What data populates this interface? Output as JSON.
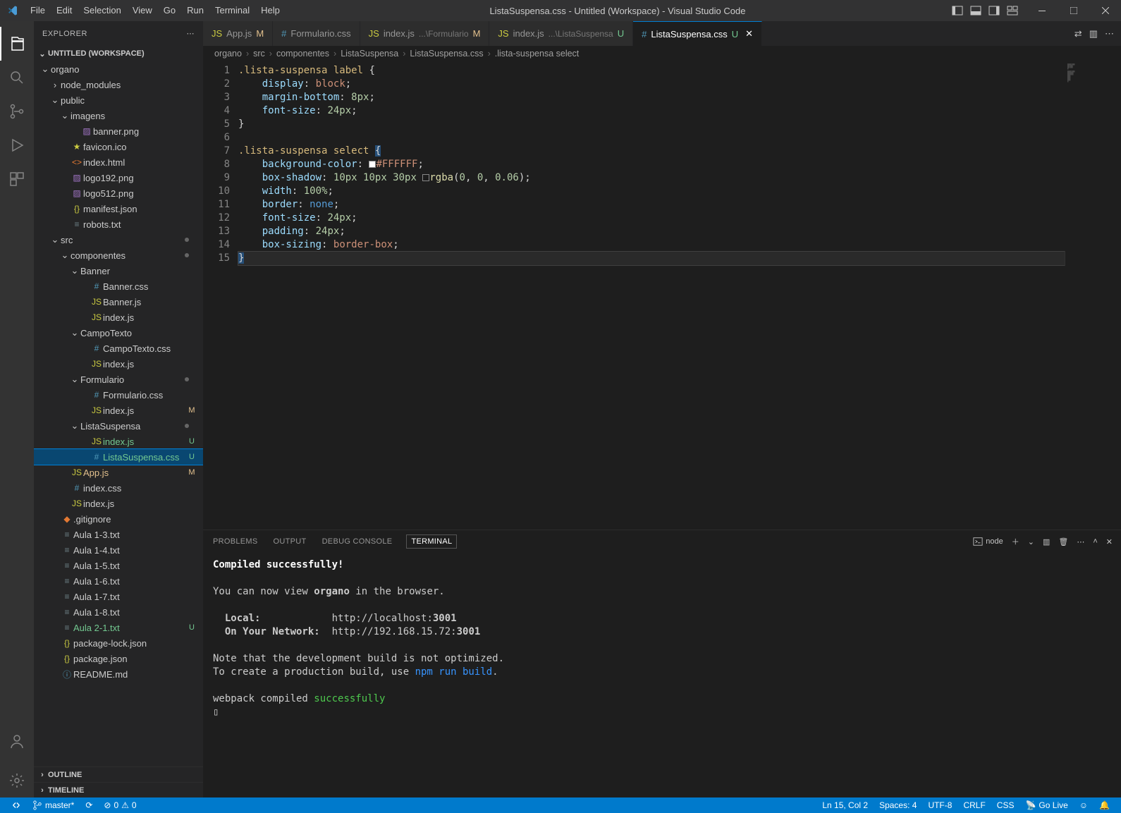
{
  "window": {
    "title": "ListaSuspensa.css - Untitled (Workspace) - Visual Studio Code"
  },
  "menu": [
    "File",
    "Edit",
    "Selection",
    "View",
    "Go",
    "Run",
    "Terminal",
    "Help"
  ],
  "activitybar": {
    "items": [
      "explorer",
      "search",
      "source-control",
      "run-debug",
      "extensions"
    ]
  },
  "sidebar": {
    "title": "EXPLORER",
    "workspace_label": "UNTITLED (WORKSPACE)",
    "tree": [
      {
        "depth": 0,
        "kind": "folder",
        "open": true,
        "name": "organo"
      },
      {
        "depth": 1,
        "kind": "folder",
        "open": false,
        "name": "node_modules"
      },
      {
        "depth": 1,
        "kind": "folder",
        "open": true,
        "name": "public"
      },
      {
        "depth": 2,
        "kind": "folder",
        "open": true,
        "name": "imagens"
      },
      {
        "depth": 3,
        "kind": "file",
        "icon": "img",
        "name": "banner.png"
      },
      {
        "depth": 2,
        "kind": "file",
        "icon": "fav",
        "name": "favicon.ico"
      },
      {
        "depth": 2,
        "kind": "file",
        "icon": "html",
        "name": "index.html"
      },
      {
        "depth": 2,
        "kind": "file",
        "icon": "img",
        "name": "logo192.png"
      },
      {
        "depth": 2,
        "kind": "file",
        "icon": "img",
        "name": "logo512.png"
      },
      {
        "depth": 2,
        "kind": "file",
        "icon": "json",
        "name": "manifest.json"
      },
      {
        "depth": 2,
        "kind": "file",
        "icon": "txt",
        "name": "robots.txt"
      },
      {
        "depth": 1,
        "kind": "folder",
        "open": true,
        "name": "src",
        "dot": true
      },
      {
        "depth": 2,
        "kind": "folder",
        "open": true,
        "name": "componentes",
        "dot": true
      },
      {
        "depth": 3,
        "kind": "folder",
        "open": true,
        "name": "Banner"
      },
      {
        "depth": 4,
        "kind": "file",
        "icon": "css",
        "name": "Banner.css"
      },
      {
        "depth": 4,
        "kind": "file",
        "icon": "js",
        "name": "Banner.js"
      },
      {
        "depth": 4,
        "kind": "file",
        "icon": "js",
        "name": "index.js"
      },
      {
        "depth": 3,
        "kind": "folder",
        "open": true,
        "name": "CampoTexto"
      },
      {
        "depth": 4,
        "kind": "file",
        "icon": "css",
        "name": "CampoTexto.css"
      },
      {
        "depth": 4,
        "kind": "file",
        "icon": "js",
        "name": "index.js"
      },
      {
        "depth": 3,
        "kind": "folder",
        "open": true,
        "name": "Formulario",
        "dot": true
      },
      {
        "depth": 4,
        "kind": "file",
        "icon": "css",
        "name": "Formulario.css"
      },
      {
        "depth": 4,
        "kind": "file",
        "icon": "js",
        "name": "index.js",
        "badge": "M"
      },
      {
        "depth": 3,
        "kind": "folder",
        "open": true,
        "name": "ListaSuspensa",
        "dot": true
      },
      {
        "depth": 4,
        "kind": "file",
        "icon": "js",
        "name": "index.js",
        "badge": "U",
        "git": "u"
      },
      {
        "depth": 4,
        "kind": "file",
        "icon": "css",
        "name": "ListaSuspensa.css",
        "badge": "U",
        "git": "u",
        "selected": true
      },
      {
        "depth": 2,
        "kind": "file",
        "icon": "js",
        "name": "App.js",
        "badge": "M",
        "git": "m"
      },
      {
        "depth": 2,
        "kind": "file",
        "icon": "css",
        "name": "index.css"
      },
      {
        "depth": 2,
        "kind": "file",
        "icon": "js",
        "name": "index.js"
      },
      {
        "depth": 1,
        "kind": "file",
        "icon": "git",
        "name": ".gitignore"
      },
      {
        "depth": 1,
        "kind": "file",
        "icon": "txt",
        "name": "Aula 1-3.txt"
      },
      {
        "depth": 1,
        "kind": "file",
        "icon": "txt",
        "name": "Aula 1-4.txt"
      },
      {
        "depth": 1,
        "kind": "file",
        "icon": "txt",
        "name": "Aula 1-5.txt"
      },
      {
        "depth": 1,
        "kind": "file",
        "icon": "txt",
        "name": "Aula 1-6.txt"
      },
      {
        "depth": 1,
        "kind": "file",
        "icon": "txt",
        "name": "Aula 1-7.txt"
      },
      {
        "depth": 1,
        "kind": "file",
        "icon": "txt",
        "name": "Aula 1-8.txt"
      },
      {
        "depth": 1,
        "kind": "file",
        "icon": "txt",
        "name": "Aula 2-1.txt",
        "badge": "U",
        "git": "u"
      },
      {
        "depth": 1,
        "kind": "file",
        "icon": "json",
        "name": "package-lock.json"
      },
      {
        "depth": 1,
        "kind": "file",
        "icon": "json",
        "name": "package.json"
      },
      {
        "depth": 1,
        "kind": "file",
        "icon": "md",
        "name": "README.md"
      }
    ],
    "outline": "OUTLINE",
    "timeline": "TIMELINE"
  },
  "tabs": [
    {
      "icon": "js",
      "label": "App.js",
      "suffix": "M",
      "suffixClass": "mod"
    },
    {
      "icon": "css",
      "label": "Formulario.css"
    },
    {
      "icon": "js",
      "label": "index.js",
      "dim": "...\\Formulario",
      "suffix": "M",
      "suffixClass": "mod"
    },
    {
      "icon": "js",
      "label": "index.js",
      "dim": "...\\ListaSuspensa",
      "suffix": "U",
      "suffixClass": "umod"
    },
    {
      "icon": "css",
      "label": "ListaSuspensa.css",
      "suffix": "U",
      "suffixClass": "umod",
      "active": true,
      "close": true
    }
  ],
  "breadcrumbs": [
    "organo",
    "src",
    "componentes",
    "ListaSuspensa",
    "ListaSuspensa.css",
    ".lista-suspensa select"
  ],
  "code": {
    "lines": [
      {
        "n": 1,
        "html": "<span class='tok-selector'>.lista-suspensa label</span> <span class='tok-punc'>{</span>"
      },
      {
        "n": 2,
        "html": "    <span class='tok-prop'>display</span><span class='tok-punc'>:</span> <span class='tok-val'>block</span><span class='tok-punc'>;</span>"
      },
      {
        "n": 3,
        "html": "    <span class='tok-prop'>margin-bottom</span><span class='tok-punc'>:</span> <span class='tok-num'>8px</span><span class='tok-punc'>;</span>"
      },
      {
        "n": 4,
        "html": "    <span class='tok-prop'>font-size</span><span class='tok-punc'>:</span> <span class='tok-num'>24px</span><span class='tok-punc'>;</span>"
      },
      {
        "n": 5,
        "html": "<span class='tok-punc'>}</span>"
      },
      {
        "n": 6,
        "html": ""
      },
      {
        "n": 7,
        "html": "<span class='tok-selector'>.lista-suspensa select</span> <span class='tok-punc sel'>{</span>"
      },
      {
        "n": 8,
        "html": "    <span class='tok-prop'>background-color</span><span class='tok-punc'>:</span> <span style='display:inline-block;width:10px;height:10px;background:#FFFFFF;border:1px solid #888;vertical-align:middle;'></span><span class='tok-val'>#FFFFFF</span><span class='tok-punc'>;</span>"
      },
      {
        "n": 9,
        "html": "    <span class='tok-prop'>box-shadow</span><span class='tok-punc'>:</span> <span class='tok-num'>10px 10px 30px</span> <span style='display:inline-block;width:10px;height:10px;background:rgba(0,0,0,0.06);border:1px solid #888;vertical-align:middle;'></span><span class='tok-func'>rgba</span><span class='tok-punc'>(</span><span class='tok-num'>0</span><span class='tok-punc'>,</span> <span class='tok-num'>0</span><span class='tok-punc'>,</span> <span class='tok-num'>0.06</span><span class='tok-punc'>);</span>"
      },
      {
        "n": 10,
        "html": "    <span class='tok-prop'>width</span><span class='tok-punc'>:</span> <span class='tok-num'>100%</span><span class='tok-punc'>;</span>"
      },
      {
        "n": 11,
        "html": "    <span class='tok-prop'>border</span><span class='tok-punc'>:</span> <span class='tok-const'>none</span><span class='tok-punc'>;</span>"
      },
      {
        "n": 12,
        "html": "    <span class='tok-prop'>font-size</span><span class='tok-punc'>:</span> <span class='tok-num'>24px</span><span class='tok-punc'>;</span>"
      },
      {
        "n": 13,
        "html": "    <span class='tok-prop'>padding</span><span class='tok-punc'>:</span> <span class='tok-num'>24px</span><span class='tok-punc'>;</span>"
      },
      {
        "n": 14,
        "html": "    <span class='tok-prop'>box-sizing</span><span class='tok-punc'>:</span> <span class='tok-val'>border-box</span><span class='tok-punc'>;</span>"
      },
      {
        "n": 15,
        "html": "<span class='tok-punc sel'>}</span>",
        "cursor": true
      }
    ]
  },
  "panel": {
    "tabs": [
      "PROBLEMS",
      "OUTPUT",
      "DEBUG CONSOLE",
      "TERMINAL"
    ],
    "active_tab": "TERMINAL",
    "shell_label": "node",
    "terminal_lines": [
      {
        "cls": "green bold",
        "text": "Compiled successfully!"
      },
      {
        "cls": "",
        "text": ""
      },
      {
        "cls": "",
        "text": "You can now view <b>organo</b> in the browser."
      },
      {
        "cls": "",
        "text": ""
      },
      {
        "cls": "",
        "text": "  <b>Local:</b>            http://localhost:<b>3001</b>"
      },
      {
        "cls": "",
        "text": "  <b>On Your Network:</b>  http://192.168.15.72:<b>3001</b>"
      },
      {
        "cls": "",
        "text": ""
      },
      {
        "cls": "",
        "text": "Note that the development build is not optimized."
      },
      {
        "cls": "",
        "text": "To create a production build, use <span class='cyan'>npm run build</span>."
      },
      {
        "cls": "",
        "text": ""
      },
      {
        "cls": "",
        "text": "webpack compiled <span class='green'>successfully</span>"
      },
      {
        "cls": "",
        "text": "▯"
      }
    ]
  },
  "statusbar": {
    "branch": "master*",
    "sync": "⟳",
    "errors": "0",
    "warnings": "0",
    "cursor": "Ln 15, Col 2",
    "spaces": "Spaces: 4",
    "encoding": "UTF-8",
    "eol": "CRLF",
    "lang": "CSS",
    "golive": "Go Live",
    "feedback": "☺",
    "bell": "🔔"
  },
  "icons": {
    "css": "#",
    "js": "JS",
    "json": "{}",
    "html": "<>",
    "img": "▨",
    "txt": "≡",
    "fav": "★",
    "git": "◆",
    "md": "ⓘ"
  }
}
